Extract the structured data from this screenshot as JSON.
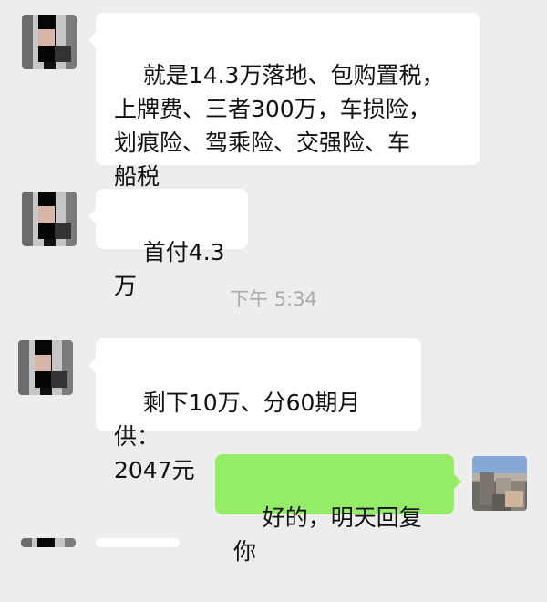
{
  "chat": {
    "messages": [
      {
        "text": "就是14.3万落地、包购置税，\n上牌费、三者300万，车损险，\n划痕险、驾乘险、交强险、车\n船税"
      },
      {
        "text": "首付4.3万"
      },
      {
        "text": "剩下10万、分60期月供：\n2047元"
      },
      {
        "text": "好的，明天回复你"
      }
    ],
    "time_divider": "下午 5:34"
  }
}
